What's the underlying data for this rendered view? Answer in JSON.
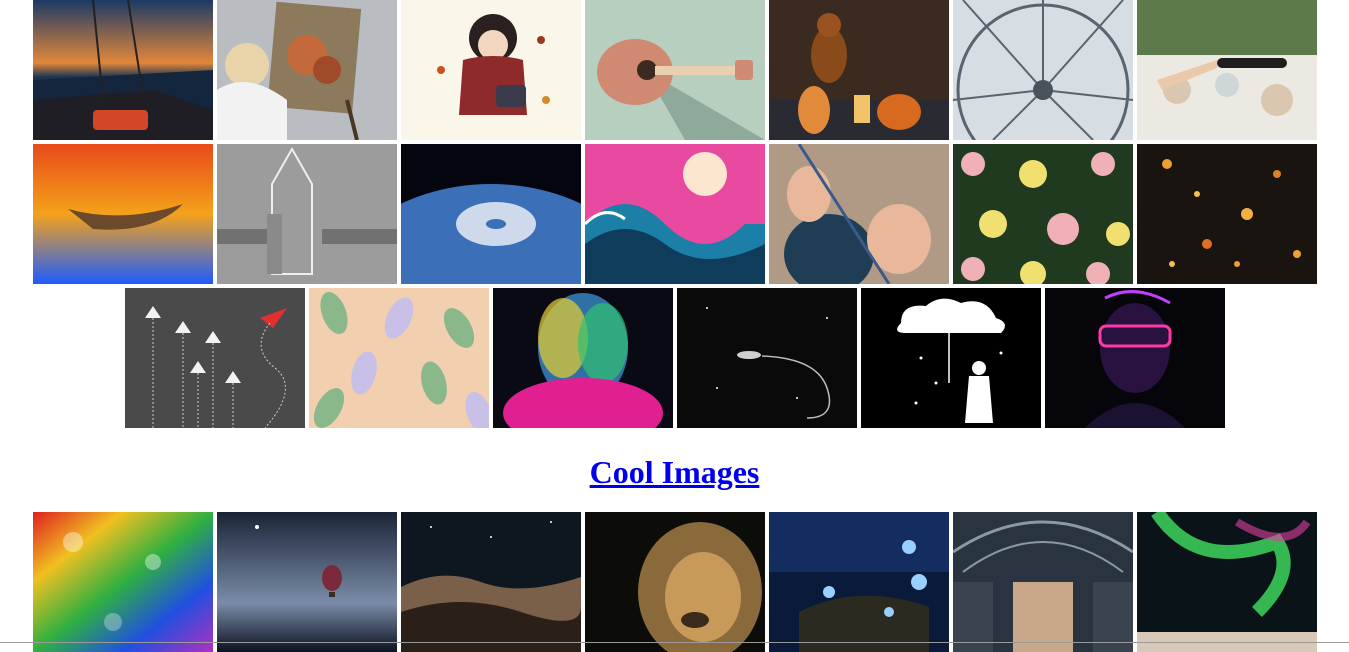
{
  "section": {
    "heading_link": "Cool Images"
  },
  "gallery": {
    "row1": [
      "sailboat-sunset-image",
      "woman-painting-easel-image",
      "girl-illustration-image",
      "guitar-illustration-image",
      "dog-pumpkins-image",
      "ferris-wheel-image",
      "wine-pouring-dinner-image"
    ],
    "row2": [
      "boat-on-golden-water-image",
      "rocket-chalk-drawing-image",
      "earth-hurricane-image",
      "great-wave-illustration-image",
      "knitting-hands-image",
      "floral-pattern-image",
      "sparklers-bokeh-image"
    ],
    "row3": [
      "paper-planes-image",
      "leaf-pattern-image",
      "neon-rainbow-face-image",
      "astronaut-tether-image",
      "cloud-umbrella-illustration-image",
      "neon-glasses-portrait-image"
    ],
    "row4": [
      "rainbow-glitter-image",
      "hot-air-balloon-night-image",
      "mountains-starry-sky-image",
      "lion-portrait-image",
      "glowing-butterflies-image",
      "museum-hall-image",
      "aurora-borealis-image"
    ]
  },
  "colors": {
    "link": "#0000ee",
    "page_background": "#ffffff"
  }
}
